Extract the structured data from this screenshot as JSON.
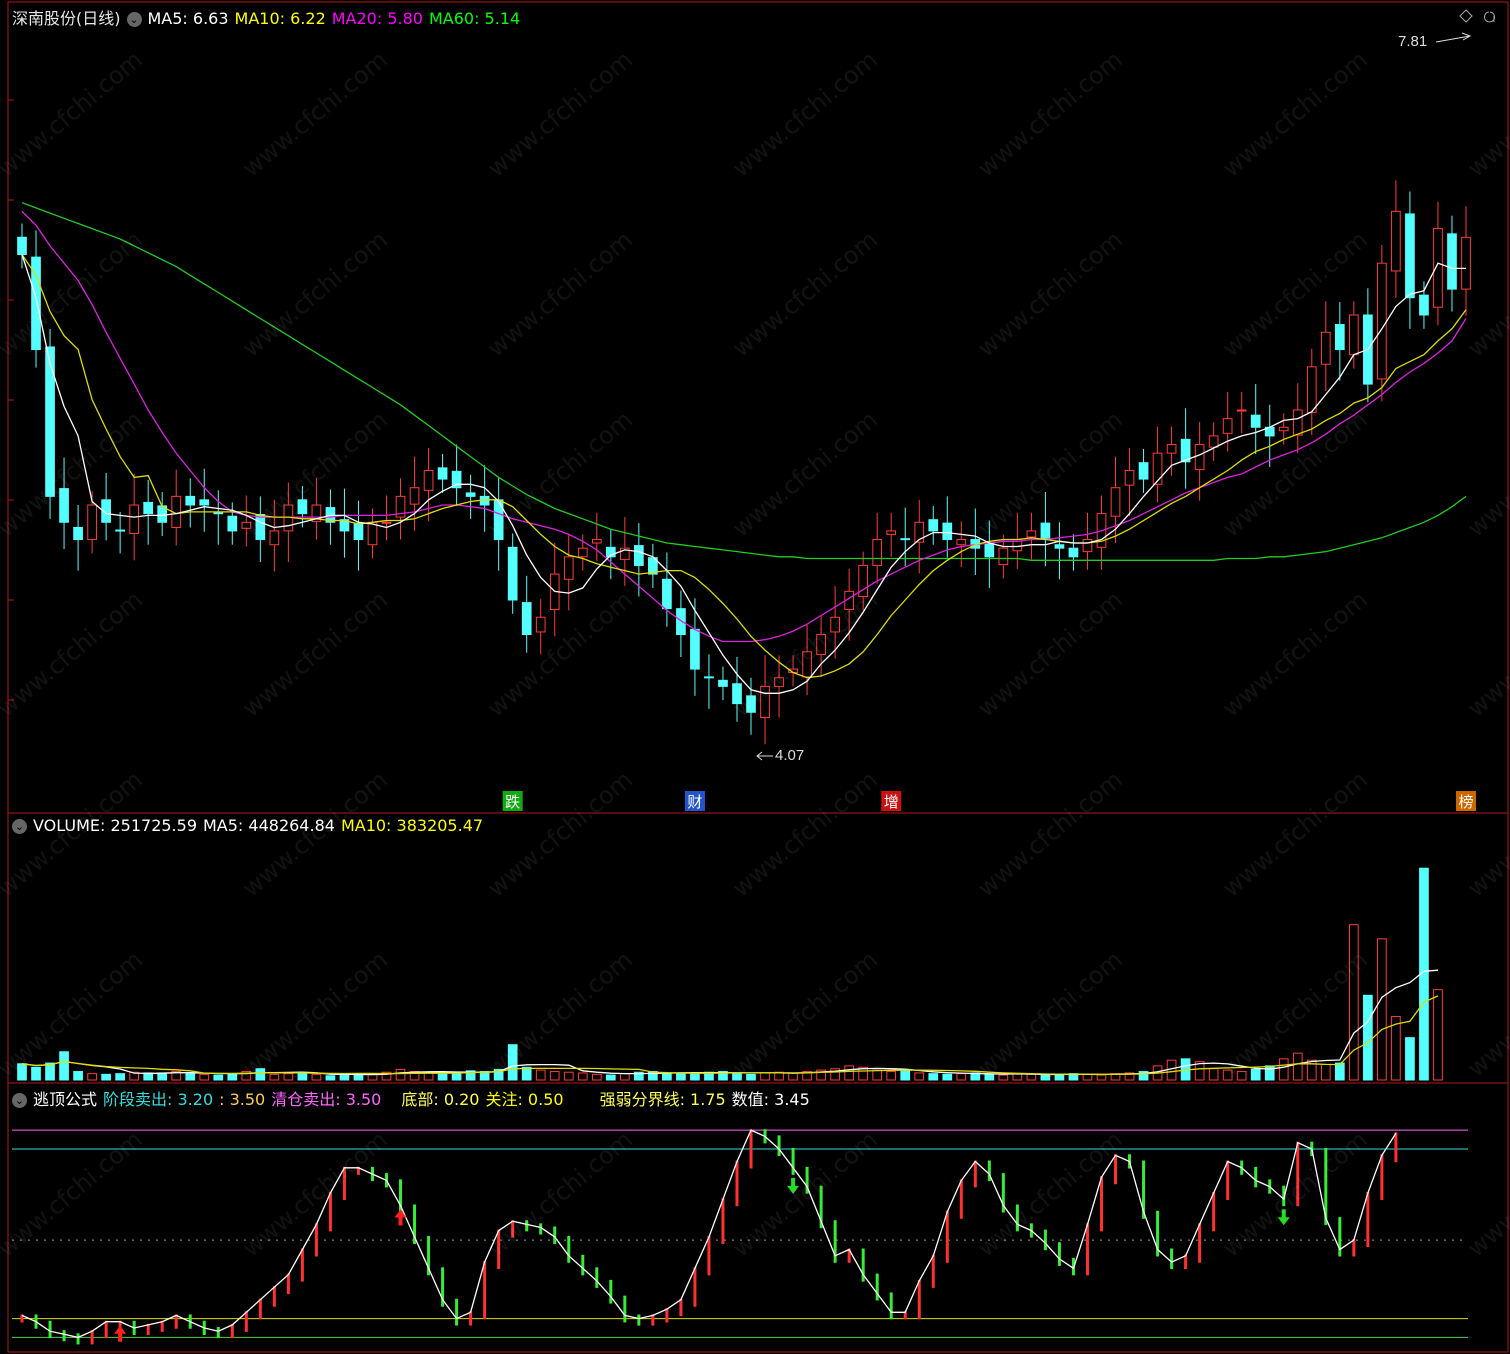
{
  "main": {
    "title": "深南股份(日线)",
    "ma": [
      {
        "label": "MA5: 6.63",
        "color": "#ffffff"
      },
      {
        "label": "MA10: 6.22",
        "color": "#ffff00"
      },
      {
        "label": "MA20: 5.80",
        "color": "#ff00ff"
      },
      {
        "label": "MA60: 5.14",
        "color": "#00ff00"
      }
    ],
    "high_label": "7.81",
    "low_label": "4.07",
    "markers": [
      {
        "text": "跌",
        "bg": "#11aa11"
      },
      {
        "text": "财",
        "bg": "#2255cc"
      },
      {
        "text": "增",
        "bg": "#cc1111"
      },
      {
        "text": "榜",
        "bg": "#cc6600"
      }
    ]
  },
  "volume": {
    "labels": [
      {
        "text": "VOLUME: 251725.59",
        "color": "#ffffff"
      },
      {
        "text": "MA5: 448264.84",
        "color": "#ffffff"
      },
      {
        "text": "MA10: 383205.47",
        "color": "#ffff00"
      }
    ]
  },
  "indicator": {
    "labels": [
      {
        "text": "逃顶公式",
        "color": "#ffffff"
      },
      {
        "text": "阶段卖出: 3.20",
        "color": "#33dddd"
      },
      {
        "text": ": 3.50",
        "color": "#ffcc55"
      },
      {
        "text": "清仓卖出: 3.50",
        "color": "#ff66ff"
      },
      {
        "text": "底部: 0.20",
        "color": "#ffff55"
      },
      {
        "text": "关注: 0.50",
        "color": "#ffff00"
      },
      {
        "text": "强弱分界线: 1.75",
        "color": "#ffff55"
      },
      {
        "text": "数值: 3.45",
        "color": "#ffffff"
      }
    ]
  },
  "watermark": "www.cfchi.com",
  "colors": {
    "up": "#ff3b3b",
    "down": "#54ffff",
    "frame": "#b01818"
  },
  "chart_data": [
    {
      "type": "candlestick",
      "price_range": [
        3.85,
        8.25
      ],
      "high": 7.81,
      "low": 4.07,
      "close": [
        6.95,
        6.4,
        5.55,
        5.4,
        5.3,
        5.5,
        5.4,
        5.35,
        5.5,
        5.45,
        5.4,
        5.55,
        5.5,
        5.5,
        5.45,
        5.35,
        5.4,
        5.3,
        5.35,
        5.5,
        5.45,
        5.5,
        5.4,
        5.35,
        5.3,
        5.4,
        5.4,
        5.55,
        5.6,
        5.7,
        5.65,
        5.6,
        5.55,
        5.5,
        5.3,
        4.95,
        4.75,
        4.85,
        5.1,
        5.2,
        5.25,
        5.3,
        5.2,
        5.25,
        5.15,
        5.1,
        4.9,
        4.75,
        4.55,
        4.5,
        4.45,
        4.35,
        4.3,
        4.45,
        4.5,
        4.55,
        4.65,
        4.75,
        4.85,
        5.0,
        5.15,
        5.3,
        5.35,
        5.3,
        5.4,
        5.35,
        5.3,
        5.3,
        5.25,
        5.2,
        5.25,
        5.3,
        5.35,
        5.3,
        5.25,
        5.2,
        5.3,
        5.45,
        5.6,
        5.7,
        5.65,
        5.8,
        5.85,
        5.75,
        5.85,
        5.9,
        6.0,
        6.05,
        5.95,
        5.9,
        5.95,
        6.05,
        6.3,
        6.5,
        6.4,
        6.6,
        6.2,
        6.9,
        7.2,
        6.7,
        6.6,
        7.1,
        6.75,
        7.05
      ],
      "ma5": [
        6.95,
        6.7,
        6.32,
        6.07,
        5.9,
        5.52,
        5.45,
        5.44,
        5.43,
        5.44,
        5.44,
        5.45,
        5.47,
        5.49,
        5.48,
        5.47,
        5.44,
        5.4,
        5.37,
        5.38,
        5.4,
        5.42,
        5.44,
        5.44,
        5.4,
        5.39,
        5.37,
        5.4,
        5.45,
        5.53,
        5.58,
        5.62,
        5.62,
        5.6,
        5.52,
        5.38,
        5.21,
        5.08,
        5.0,
        4.99,
        5.02,
        5.13,
        5.21,
        5.24,
        5.23,
        5.2,
        5.12,
        5.03,
        4.89,
        4.76,
        4.63,
        4.52,
        4.43,
        4.41,
        4.41,
        4.43,
        4.48,
        4.58,
        4.66,
        4.76,
        4.88,
        5.01,
        5.14,
        5.23,
        5.3,
        5.34,
        5.34,
        5.33,
        5.32,
        5.28,
        5.26,
        5.26,
        5.27,
        5.27,
        5.29,
        5.28,
        5.28,
        5.3,
        5.36,
        5.45,
        5.55,
        5.64,
        5.73,
        5.76,
        5.79,
        5.83,
        5.87,
        5.9,
        5.92,
        5.95,
        5.99,
        6.0,
        6.04,
        6.14,
        6.24,
        6.37,
        6.4,
        6.52,
        6.65,
        6.72,
        6.74,
        6.9,
        6.87,
        6.87
      ],
      "ma10": [
        6.95,
        6.83,
        6.62,
        6.48,
        6.4,
        6.11,
        5.94,
        5.78,
        5.66,
        5.67,
        5.49,
        5.45,
        5.46,
        5.46,
        5.46,
        5.46,
        5.46,
        5.44,
        5.43,
        5.43,
        5.42,
        5.42,
        5.41,
        5.41,
        5.39,
        5.4,
        5.41,
        5.41,
        5.42,
        5.45,
        5.48,
        5.5,
        5.52,
        5.53,
        5.53,
        5.49,
        5.41,
        5.33,
        5.26,
        5.21,
        5.19,
        5.16,
        5.14,
        5.12,
        5.1,
        5.11,
        5.12,
        5.12,
        5.08,
        5.01,
        4.93,
        4.84,
        4.74,
        4.66,
        4.59,
        4.53,
        4.5,
        4.51,
        4.54,
        4.58,
        4.65,
        4.75,
        4.86,
        4.95,
        5.04,
        5.12,
        5.18,
        5.23,
        5.27,
        5.29,
        5.3,
        5.3,
        5.31,
        5.3,
        5.29,
        5.28,
        5.28,
        5.29,
        5.32,
        5.36,
        5.41,
        5.46,
        5.51,
        5.55,
        5.6,
        5.65,
        5.7,
        5.76,
        5.81,
        5.84,
        5.88,
        5.91,
        5.94,
        5.99,
        6.03,
        6.09,
        6.12,
        6.18,
        6.29,
        6.33,
        6.37,
        6.45,
        6.52,
        6.63
      ],
      "ma20": [
        7.2,
        7.12,
        7.0,
        6.9,
        6.8,
        6.66,
        6.5,
        6.35,
        6.2,
        6.05,
        5.92,
        5.8,
        5.7,
        5.6,
        5.52,
        5.46,
        5.44,
        5.43,
        5.43,
        5.43,
        5.43,
        5.43,
        5.43,
        5.44,
        5.44,
        5.44,
        5.44,
        5.45,
        5.46,
        5.48,
        5.5,
        5.5,
        5.49,
        5.48,
        5.45,
        5.42,
        5.4,
        5.38,
        5.36,
        5.33,
        5.29,
        5.24,
        5.17,
        5.1,
        5.03,
        4.96,
        4.89,
        4.83,
        4.78,
        4.74,
        4.71,
        4.71,
        4.71,
        4.72,
        4.74,
        4.77,
        4.81,
        4.86,
        4.91,
        4.96,
        5.01,
        5.06,
        5.1,
        5.14,
        5.18,
        5.21,
        5.24,
        5.26,
        5.27,
        5.28,
        5.29,
        5.29,
        5.3,
        5.3,
        5.31,
        5.32,
        5.33,
        5.35,
        5.38,
        5.41,
        5.45,
        5.49,
        5.53,
        5.57,
        5.6,
        5.63,
        5.66,
        5.68,
        5.72,
        5.76,
        5.79,
        5.82,
        5.86,
        5.91,
        5.97,
        6.02,
        6.08,
        6.14,
        6.21,
        6.27,
        6.32,
        6.38,
        6.45,
        6.58
      ],
      "ma60": [
        7.25,
        7.22,
        7.19,
        7.16,
        7.13,
        7.1,
        7.07,
        7.04,
        7.0,
        6.96,
        6.92,
        6.88,
        6.83,
        6.78,
        6.73,
        6.68,
        6.63,
        6.58,
        6.53,
        6.48,
        6.43,
        6.38,
        6.33,
        6.28,
        6.23,
        6.18,
        6.13,
        6.08,
        6.02,
        5.96,
        5.9,
        5.84,
        5.78,
        5.72,
        5.66,
        5.61,
        5.56,
        5.52,
        5.48,
        5.45,
        5.42,
        5.39,
        5.36,
        5.34,
        5.32,
        5.3,
        5.28,
        5.27,
        5.26,
        5.25,
        5.24,
        5.23,
        5.22,
        5.21,
        5.2,
        5.2,
        5.19,
        5.19,
        5.19,
        5.19,
        5.19,
        5.19,
        5.19,
        5.19,
        5.19,
        5.19,
        5.19,
        5.19,
        5.19,
        5.19,
        5.19,
        5.19,
        5.18,
        5.18,
        5.18,
        5.18,
        5.18,
        5.18,
        5.18,
        5.18,
        5.18,
        5.18,
        5.18,
        5.18,
        5.18,
        5.18,
        5.19,
        5.19,
        5.19,
        5.2,
        5.2,
        5.21,
        5.22,
        5.23,
        5.25,
        5.27,
        5.29,
        5.31,
        5.34,
        5.37,
        5.4,
        5.44,
        5.49,
        5.55
      ]
    },
    {
      "type": "bar",
      "name": "VOLUME",
      "volume": [
        115000,
        90000,
        120000,
        200000,
        60000,
        45000,
        40000,
        45000,
        55000,
        50000,
        50000,
        60000,
        45000,
        40000,
        35000,
        45000,
        60000,
        80000,
        40000,
        45000,
        50000,
        40000,
        30000,
        35000,
        40000,
        45000,
        55000,
        75000,
        60000,
        55000,
        50000,
        45000,
        65000,
        60000,
        75000,
        250000,
        90000,
        70000,
        60000,
        55000,
        50000,
        40000,
        35000,
        45000,
        55000,
        60000,
        50000,
        45000,
        50000,
        55000,
        60000,
        45000,
        40000,
        50000,
        55000,
        50000,
        60000,
        70000,
        80000,
        100000,
        90000,
        70000,
        60000,
        65000,
        50000,
        45000,
        40000,
        45000,
        50000,
        40000,
        35000,
        45000,
        40000,
        35000,
        40000,
        45000,
        40000,
        35000,
        45000,
        50000,
        60000,
        100000,
        140000,
        150000,
        130000,
        80000,
        70000,
        60000,
        75000,
        100000,
        150000,
        190000,
        140000,
        110000,
        120000,
        1100000,
        600000,
        1000000,
        450000,
        300000,
        1500000,
        640000
      ],
      "ylim": [
        0,
        1700000
      ]
    },
    {
      "type": "line",
      "name": "逃顶公式",
      "ylim": [
        0,
        3.9
      ],
      "levels": {
        "清仓卖出": 3.5,
        "阶段卖出": 3.2,
        "关注": 0.5,
        "底部": 0.2
      },
      "values": [
        0.55,
        0.45,
        0.3,
        0.25,
        0.2,
        0.3,
        0.45,
        0.45,
        0.35,
        0.4,
        0.45,
        0.55,
        0.45,
        0.35,
        0.3,
        0.4,
        0.6,
        0.8,
        1.0,
        1.2,
        1.6,
        2.0,
        2.5,
        2.9,
        2.9,
        2.8,
        2.7,
        2.3,
        1.8,
        1.3,
        0.8,
        0.5,
        0.6,
        1.4,
        1.9,
        2.05,
        2.0,
        1.95,
        1.8,
        1.5,
        1.3,
        1.1,
        0.85,
        0.55,
        0.5,
        0.55,
        0.65,
        0.8,
        1.3,
        1.8,
        2.4,
        3.0,
        3.5,
        3.4,
        3.2,
        2.9,
        2.6,
        2.05,
        1.5,
        1.6,
        1.2,
        0.9,
        0.6,
        0.6,
        1.1,
        1.5,
        2.2,
        2.7,
        3.0,
        2.8,
        2.3,
        2.0,
        1.9,
        1.7,
        1.45,
        1.3,
        2.0,
        2.75,
        3.1,
        3.0,
        2.2,
        1.6,
        1.4,
        1.5,
        2.0,
        2.5,
        3.0,
        2.9,
        2.7,
        2.6,
        2.4,
        3.3,
        3.2,
        2.1,
        1.6,
        1.75,
        2.5,
        3.1,
        3.45
      ]
    }
  ]
}
